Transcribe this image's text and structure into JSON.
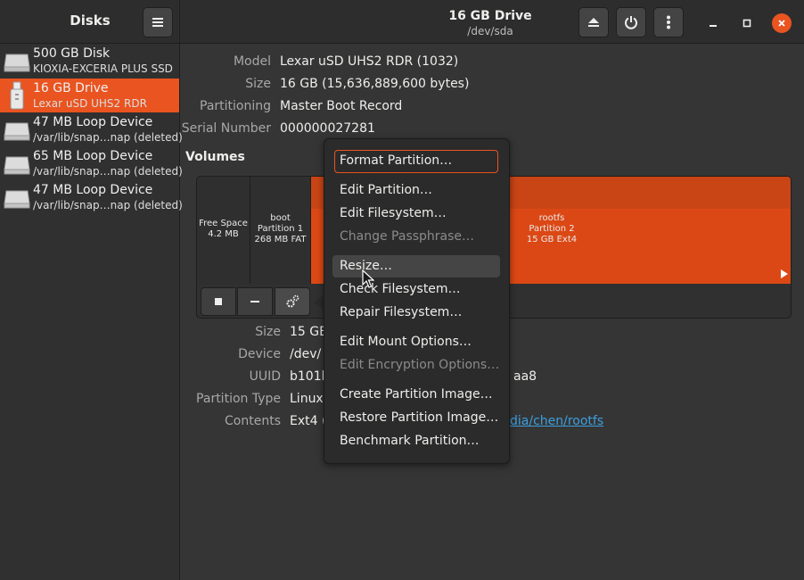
{
  "header": {
    "app_title": "Disks",
    "drive_title": "16 GB Drive",
    "drive_path": "/dev/sda"
  },
  "sidebar": {
    "items": [
      {
        "name": "500 GB Disk",
        "sub": "KIOXIA-EXCERIA PLUS SSD",
        "icon": "ssd-icon",
        "selected": false
      },
      {
        "name": "16 GB Drive",
        "sub": "Lexar uSD UHS2 RDR",
        "icon": "usb-drive-icon",
        "selected": true
      },
      {
        "name": "47 MB Loop Device",
        "sub": "/var/lib/snap…nap (deleted)",
        "icon": "disk-icon",
        "selected": false
      },
      {
        "name": "65 MB Loop Device",
        "sub": "/var/lib/snap…nap (deleted)",
        "icon": "disk-icon",
        "selected": false
      },
      {
        "name": "47 MB Loop Device",
        "sub": "/var/lib/snap…nap (deleted)",
        "icon": "disk-icon",
        "selected": false
      }
    ]
  },
  "drive_info": {
    "model_label": "Model",
    "model": "Lexar uSD UHS2 RDR (1032)",
    "size_label": "Size",
    "size": "16 GB (15,636,889,600 bytes)",
    "partitioning_label": "Partitioning",
    "partitioning": "Master Boot Record",
    "serial_label": "Serial Number",
    "serial": "000000027281"
  },
  "volumes": {
    "heading": "Volumes",
    "segments": [
      {
        "l1": "Free Space",
        "l2": "4.2 MB",
        "l3": ""
      },
      {
        "l1": "boot",
        "l2": "Partition 1",
        "l3": "268 MB FAT"
      },
      {
        "l1": "rootfs",
        "l2": "Partition 2",
        "l3": "15 GB Ext4"
      }
    ]
  },
  "partition_info": {
    "size_label": "Size",
    "size": "15 GB",
    "device_label": "Device",
    "device": "/dev/",
    "uuid_label": "UUID",
    "uuid_start": "b101b",
    "uuid_end": "aa8",
    "ptype_label": "Partition Type",
    "ptype": "Linux",
    "contents_label": "Contents",
    "contents": "Ext4 (",
    "contents_link": "dia/chen/rootfs"
  },
  "menu": {
    "items": [
      {
        "label": "Format Partition…",
        "enabled": true
      },
      {
        "label": "Edit Partition…",
        "enabled": true
      },
      {
        "label": "Edit Filesystem…",
        "enabled": true
      },
      {
        "label": "Change Passphrase…",
        "enabled": false
      },
      {
        "label": "Resize…",
        "enabled": true
      },
      {
        "label": "Check Filesystem…",
        "enabled": true
      },
      {
        "label": "Repair Filesystem…",
        "enabled": true
      },
      {
        "label": "Edit Mount Options…",
        "enabled": true
      },
      {
        "label": "Edit Encryption Options…",
        "enabled": false
      },
      {
        "label": "Create Partition Image…",
        "enabled": true
      },
      {
        "label": "Restore Partition Image…",
        "enabled": true
      },
      {
        "label": "Benchmark Partition…",
        "enabled": true
      }
    ]
  },
  "colors": {
    "accent": "#e95420",
    "partition_fill": "#dc4815",
    "link": "#3c9fe0",
    "close_button": "#e95420"
  }
}
